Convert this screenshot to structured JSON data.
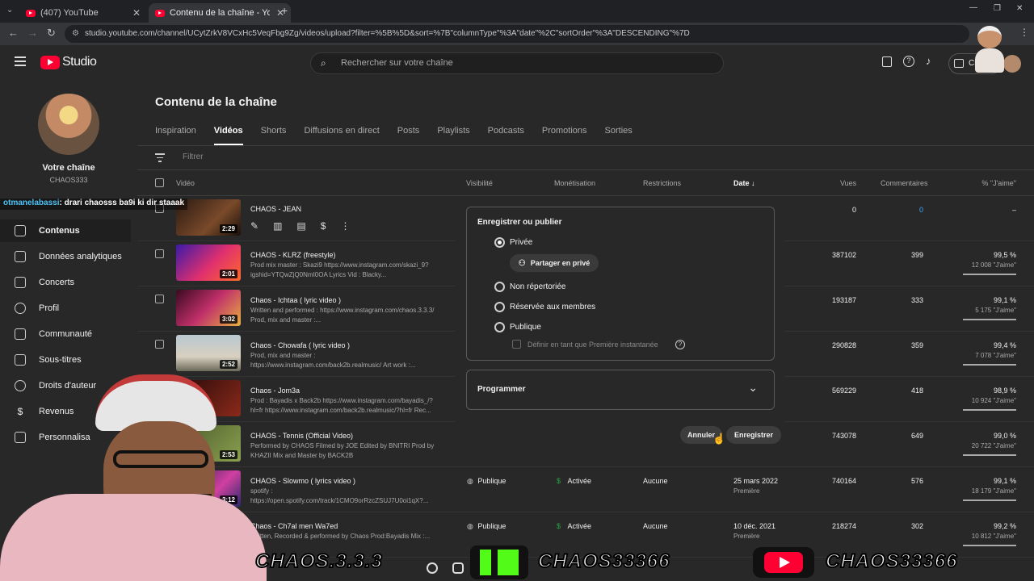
{
  "browser": {
    "tabs": [
      {
        "label": "(407) YouTube",
        "active": false
      },
      {
        "label": "Contenu de la chaîne - YouTube",
        "active": true
      }
    ],
    "url": "studio.youtube.com/channel/UCytZrkV8VCxHc5VeqFbg9Zg/videos/upload?filter=%5B%5D&sort=%7B\"columnType\"%3A\"date\"%2C\"sortOrder\"%3A\"DESCENDING\"%7D"
  },
  "header": {
    "logo": "Studio",
    "search_placeholder": "Rechercher sur votre chaîne",
    "create_label": "Créer"
  },
  "sidebar": {
    "channel_title": "Votre chaîne",
    "channel_name": "CHAOS333",
    "items": [
      {
        "label": "Contenus",
        "icon": "content-icon",
        "active": true
      },
      {
        "label": "Données analytiques",
        "icon": "analytics-icon"
      },
      {
        "label": "Concerts",
        "icon": "concerts-icon"
      },
      {
        "label": "Profil",
        "icon": "profile-icon"
      },
      {
        "label": "Communauté",
        "icon": "community-icon"
      },
      {
        "label": "Sous-titres",
        "icon": "subtitles-icon"
      },
      {
        "label": "Droits d'auteur",
        "icon": "copyright-icon"
      },
      {
        "label": "Revenus",
        "icon": "dollar-icon"
      },
      {
        "label": "Personnalisa",
        "icon": "customize-icon"
      }
    ]
  },
  "main": {
    "page_title": "Contenu de la chaîne",
    "tabs": [
      "Inspiration",
      "Vidéos",
      "Shorts",
      "Diffusions en direct",
      "Posts",
      "Playlists",
      "Podcasts",
      "Promotions",
      "Sorties"
    ],
    "active_tab": "Vidéos",
    "filter_placeholder": "Filtrer",
    "columns": {
      "video": "Vidéo",
      "visibility": "Visibilité",
      "monetization": "Monétisation",
      "restrictions": "Restrictions",
      "date": "Date",
      "views": "Vues",
      "comments": "Commentaires",
      "likes": "% \"J'aime\""
    },
    "rows": [
      {
        "title": "CHAOS - JEAN",
        "duration": "2:29",
        "views": "0",
        "comments": "0",
        "pct": "–",
        "likes": ""
      },
      {
        "title": "CHAOS - KLRZ (freestyle)",
        "desc": "Prod mix master : Skazi9 https://www.instagram.com/skazi_9?igshid=YTQwZjQ0NmI0OA Lyrics Vid : Blacky...",
        "duration": "2:01",
        "views": "387102",
        "comments": "399",
        "pct": "99,5 %",
        "likes": "12 008 \"J'aime\"",
        "ratio": 0.995
      },
      {
        "title": "Chaos - Ichtaa ( lyric video )",
        "desc": "Written and performed : https://www.instagram.com/chaos.3.3.3/ Prod, mix and master :...",
        "duration": "3:02",
        "views": "193187",
        "comments": "333",
        "pct": "99,1 %",
        "likes": "5 175 \"J'aime\"",
        "ratio": 0.991
      },
      {
        "title": "Chaos - Chowafa ( lyric video )",
        "desc": "Prod, mix and master : https://www.instagram.com/back2b.realmusic/ Art work :...",
        "duration": "2:52",
        "views": "290828",
        "comments": "359",
        "pct": "99,4 %",
        "likes": "7 078 \"J'aime\"",
        "ratio": 0.994
      },
      {
        "title": "Chaos - Jom3a",
        "desc": "Prod : Bayadis x Back2b https://www.instagram.com/bayadis_/?hl=fr https://www.instagram.com/back2b.realmusic/?hl=fr Rec...",
        "duration": "",
        "views": "569229",
        "comments": "418",
        "pct": "98,9 %",
        "likes": "10 924 \"J'aime\"",
        "ratio": 0.989
      },
      {
        "title": "CHAOS - Tennis (Official Video)",
        "desc": "Performed by CHAOS Filmed by JOE Edited by BNITRI Prod by KHAZII Mix and Master by BACK2B",
        "duration": "2:53",
        "views": "743078",
        "comments": "649",
        "pct": "99,0 %",
        "likes": "20 722 \"J'aime\"",
        "ratio": 0.99
      },
      {
        "title": "CHAOS - Slowmo ( lyrics video )",
        "desc": "spotify : https://open.spotify.com/track/1CMO9orRzcZSUJ7U0oi1qX?...",
        "duration": "3:12",
        "visibility": "Publique",
        "monetization": "Activée",
        "restrictions": "Aucune",
        "date": "25 mars 2022",
        "date_sub": "Première",
        "views": "740164",
        "comments": "576",
        "pct": "99,1 %",
        "likes": "18 179 \"J'aime\"",
        "ratio": 0.991
      },
      {
        "title": "Chaos - Ch7al men Wa7ed",
        "desc": "Written, Recorded & performed by Chaos Prod:Bayadis Mix :...",
        "duration": "",
        "visibility": "Publique",
        "monetization": "Activée",
        "restrictions": "Aucune",
        "date": "10 déc. 2021",
        "date_sub": "Première",
        "views": "218274",
        "comments": "302",
        "pct": "99,2 %",
        "likes": "10 812 \"J'aime\"",
        "ratio": 0.992
      }
    ]
  },
  "popup": {
    "title": "Enregistrer ou publier",
    "options": [
      "Privée",
      "Non répertoriée",
      "Réservée aux membres",
      "Publique"
    ],
    "selected": "Privée",
    "share_private": "Partager en privé",
    "premiere_label": "Définir en tant que Première instantanée",
    "schedule_label": "Programmer",
    "cancel_label": "Annuler",
    "save_label": "Enregistrer"
  },
  "overlay": {
    "chat_user": "otmanelabassi",
    "chat_message": ": drari chaosss ba9i ki dir staaak",
    "banner": [
      "CHAOS.3.3.3",
      "CHAOS33366",
      "CHAOS33366"
    ]
  },
  "colors": {
    "youtube_red": "#ff0033",
    "bg": "#282828",
    "link_blue": "#3ea6ff",
    "kick_green": "#53fc18"
  }
}
